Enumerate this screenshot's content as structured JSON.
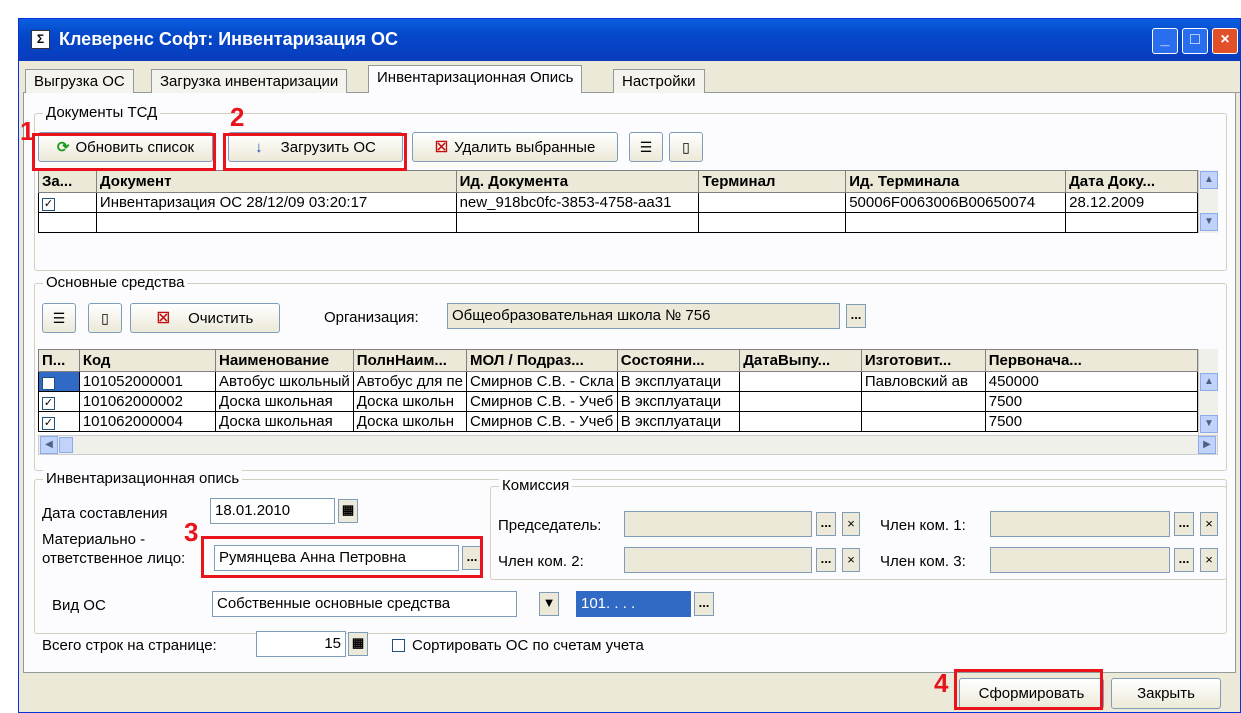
{
  "window": {
    "title": "Клеверенс Софт: Инвентаризация ОС",
    "min": "_",
    "max": "□",
    "close": "×"
  },
  "tabs": [
    "Выгрузка ОС",
    "Загрузка инвентаризации",
    "Инвентаризационная Опись",
    "Настройки"
  ],
  "docs": {
    "group_label": "Документы ТСД",
    "refresh_label": "Обновить список",
    "load_label": "Загрузить ОС",
    "delete_label": "Удалить выбранные",
    "headers": [
      "За...",
      "Документ",
      "Ид. Документа",
      "Терминал",
      "Ид. Терминала",
      "Дата Доку..."
    ],
    "rows": [
      [
        "✓",
        "Инвентаризация ОС 28/12/09 03:20:17",
        "new_918bc0fc-3853-4758-aa31",
        "",
        "50006F0063006B00650074",
        "28.12.2009"
      ]
    ]
  },
  "assets": {
    "group_label": "Основные средства",
    "clear_label": "Очистить",
    "org_label": "Организация:",
    "org_value": "Общеобразовательная школа № 756",
    "headers": [
      "П...",
      "Код",
      "Наименование",
      "ПолнНаим...",
      "МОЛ / Подраз...",
      "Состояни...",
      "ДатаВыпу...",
      "Изготовит...",
      "Первонача..."
    ],
    "rows": [
      [
        "✓",
        "101052000001",
        "Автобус школьный",
        "Автобус для пе",
        "Смирнов С.В. - Скла",
        "В эксплуатаци",
        "",
        "Павловский ав",
        "450000"
      ],
      [
        "✓",
        "101062000002",
        "Доска школьная",
        "Доска школьн",
        "Смирнов С.В. - Учеб",
        "В эксплуатаци",
        "",
        "",
        "7500"
      ],
      [
        "✓",
        "101062000004",
        "Доска школьная",
        "Доска школьн",
        "Смирнов С.В. - Учеб",
        "В эксплуатаци",
        "",
        "",
        "7500"
      ]
    ]
  },
  "inv": {
    "group_label": "Инвентаризационная опись",
    "date_label": "Дата составления",
    "date_value": "18.01.2010",
    "mol_label_1": "Материально -",
    "mol_label_2": "ответственное лицо:",
    "mol_value": "Румянцева Анна Петровна",
    "commission_label": "Комиссия",
    "chair_label": "Председатель:",
    "member1_label": "Член ком. 1:",
    "member2_label": "Член ком. 2:",
    "member3_label": "Член ком. 3:",
    "type_label": "Вид ОС",
    "type_value": "Собственные основные средства",
    "account_value": "101. . . .",
    "rows_label": "Всего строк на странице:",
    "rows_value": "15",
    "sort_label": "Сортировать ОС по счетам учета"
  },
  "footer": {
    "generate_label": "Сформировать",
    "close_label": "Закрыть"
  },
  "markers": [
    "1",
    "2",
    "3",
    "4"
  ]
}
